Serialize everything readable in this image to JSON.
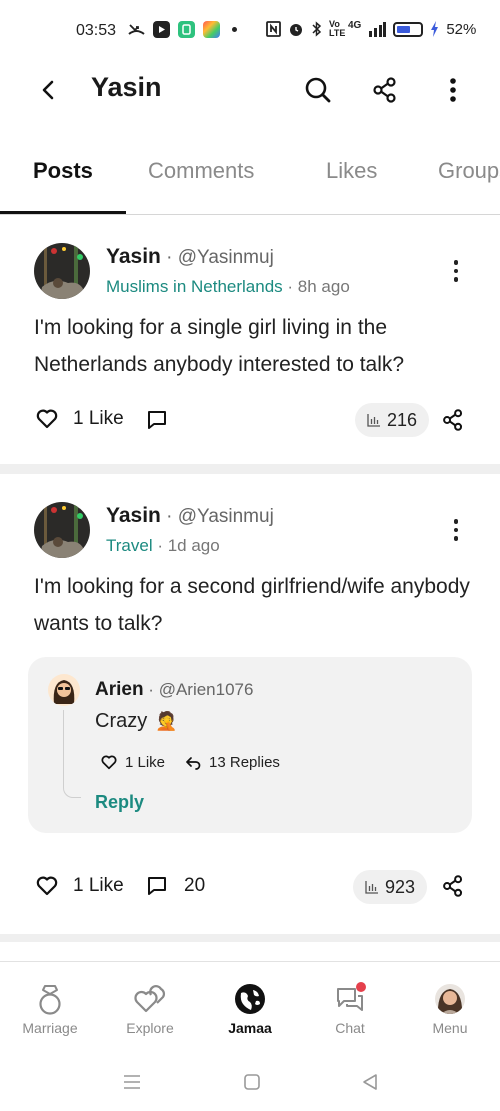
{
  "status_bar": {
    "time": "03:53",
    "network_label": "4G",
    "battery_percent": "52%"
  },
  "header": {
    "title": "Yasin",
    "back_icon": "chevron-left-icon",
    "search_icon": "search-icon",
    "share_icon": "share-icon",
    "more_icon": "more-vertical-icon"
  },
  "tabs": [
    {
      "label": "Posts",
      "active": true
    },
    {
      "label": "Comments",
      "active": false
    },
    {
      "label": "Likes",
      "active": false
    },
    {
      "label": "Groups",
      "active": false
    }
  ],
  "posts": [
    {
      "author_name": "Yasin",
      "author_handle": "@Yasinmuj",
      "group": "Muslims in Netherlands",
      "time_ago": "8h ago",
      "text": "I'm looking for a single girl living in the Netherlands anybody interested to talk?",
      "likes_label": "1 Like",
      "comments_count": "",
      "views": "216"
    },
    {
      "author_name": "Yasin",
      "author_handle": "@Yasinmuj",
      "group": "Travel",
      "time_ago": "1d ago",
      "text": "I'm looking for a second girlfriend/wife anybody wants to talk?",
      "likes_label": "1 Like",
      "comments_count": "20",
      "views": "923",
      "top_comment": {
        "author_name": "Arien",
        "author_handle": "@Arien1076",
        "text": "Crazy",
        "emoji": "🤦",
        "likes_label": "1 Like",
        "replies_label": "13 Replies",
        "reply_label": "Reply"
      }
    }
  ],
  "bottom_nav": [
    {
      "label": "Marriage",
      "icon": "ring-icon",
      "active": false
    },
    {
      "label": "Explore",
      "icon": "hearts-icon",
      "active": false
    },
    {
      "label": "Jamaa",
      "icon": "globe-icon",
      "active": true
    },
    {
      "label": "Chat",
      "icon": "chat-icon",
      "active": false
    },
    {
      "label": "Menu",
      "icon": "profile-avatar-icon",
      "active": false
    }
  ],
  "colors": {
    "accent_teal": "#1c8a80",
    "notification_red": "#e5404c",
    "text_primary": "#1a1a1a",
    "text_muted": "#8a8a8a"
  }
}
